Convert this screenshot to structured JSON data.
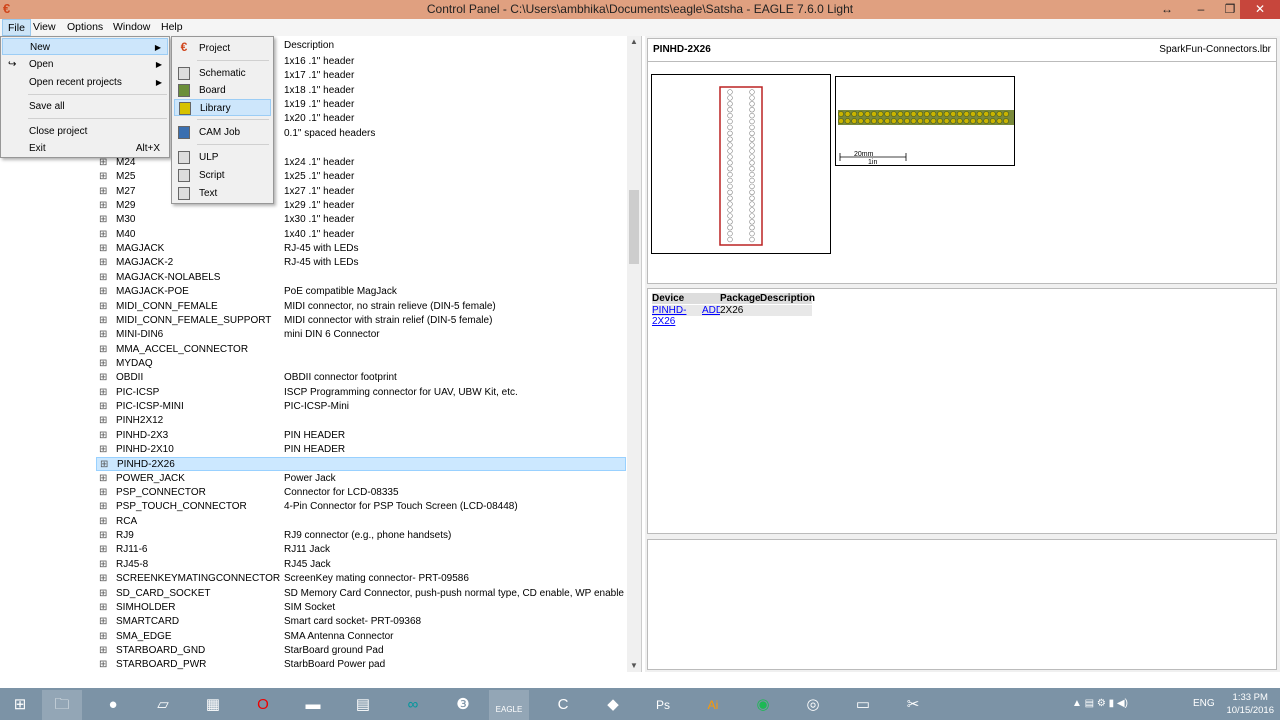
{
  "window": {
    "title": "Control Panel - C:\\Users\\ambhika\\Documents\\eagle\\Satsha - EAGLE 7.6.0 Light",
    "minimize": "–",
    "restore": "❐",
    "close": "✕",
    "extra": "↔"
  },
  "menubar": [
    "File",
    "View",
    "Options",
    "Window",
    "Help"
  ],
  "file_menu": {
    "new": "New",
    "open": "Open",
    "open_recent": "Open recent projects",
    "save_all": "Save all",
    "close_project": "Close project",
    "exit": "Exit",
    "exit_accel": "Alt+X"
  },
  "new_submenu": [
    "Project",
    "Schematic",
    "Board",
    "Library",
    "CAM Job",
    "ULP",
    "Script",
    "Text"
  ],
  "list": {
    "description_header": "Description",
    "top_descriptions": [
      "1x16 .1\" header",
      "1x17 .1\" header",
      "1x18 .1\" header",
      "1x19 .1\" header",
      "1x20 .1\" header",
      "0.1\" spaced headers"
    ],
    "rows": [
      {
        "name": "M24",
        "desc": "1x24 .1\" header"
      },
      {
        "name": "M25",
        "desc": "1x25 .1\" header"
      },
      {
        "name": "M27",
        "desc": "1x27 .1\" header"
      },
      {
        "name": "M29",
        "desc": "1x29 .1\" header"
      },
      {
        "name": "M30",
        "desc": "1x30 .1\" header"
      },
      {
        "name": "M40",
        "desc": "1x40 .1\" header"
      },
      {
        "name": "MAGJACK",
        "desc": "RJ-45 with LEDs"
      },
      {
        "name": "MAGJACK-2",
        "desc": "RJ-45 with LEDs"
      },
      {
        "name": "MAGJACK-NOLABELS",
        "desc": ""
      },
      {
        "name": "MAGJACK-POE",
        "desc": "PoE compatible MagJack"
      },
      {
        "name": "MIDI_CONN_FEMALE",
        "desc": "MIDI connector, no strain relieve (DIN-5 female)"
      },
      {
        "name": "MIDI_CONN_FEMALE_SUPPORT",
        "desc": "MIDI connector with strain relief (DIN-5 female)"
      },
      {
        "name": "MINI-DIN6",
        "desc": "mini DIN 6 Connector"
      },
      {
        "name": "MMA_ACCEL_CONNECTOR",
        "desc": ""
      },
      {
        "name": "MYDAQ",
        "desc": ""
      },
      {
        "name": "OBDII",
        "desc": "OBDII connector footprint"
      },
      {
        "name": "PIC-ICSP",
        "desc": "ISCP Programming connector for UAV, UBW Kit, etc."
      },
      {
        "name": "PIC-ICSP-MINI",
        "desc": "PIC-ICSP-Mini"
      },
      {
        "name": "PINH2X12",
        "desc": ""
      },
      {
        "name": "PINHD-2X3",
        "desc": "PIN HEADER"
      },
      {
        "name": "PINHD-2X10",
        "desc": "PIN HEADER"
      },
      {
        "name": "PINHD-2X26",
        "desc": ""
      },
      {
        "name": "POWER_JACK",
        "desc": "Power Jack"
      },
      {
        "name": "PSP_CONNECTOR",
        "desc": "Connector for LCD-08335"
      },
      {
        "name": "PSP_TOUCH_CONNECTOR",
        "desc": "4-Pin Connector for PSP Touch Screen (LCD-08448)"
      },
      {
        "name": "RCA",
        "desc": ""
      },
      {
        "name": "RJ9",
        "desc": "RJ9 connector (e.g., phone handsets)"
      },
      {
        "name": "RJ11-6",
        "desc": "RJ11 Jack"
      },
      {
        "name": "RJ45-8",
        "desc": "RJ45 Jack"
      },
      {
        "name": "SCREENKEYMATINGCONNECTOR",
        "desc": "ScreenKey mating connector- PRT-09586"
      },
      {
        "name": "SD_CARD_SOCKET",
        "desc": "SD Memory Card Connector, push-push normal type, CD enable, WP enable"
      },
      {
        "name": "SIMHOLDER",
        "desc": "SIM Socket"
      },
      {
        "name": "SMARTCARD",
        "desc": "Smart card socket- PRT-09368"
      },
      {
        "name": "SMA_EDGE",
        "desc": "SMA Antenna Connector"
      },
      {
        "name": "STARBOARD_GND",
        "desc": "StarBoard ground Pad"
      },
      {
        "name": "STARBOARD_PWR",
        "desc": "StarbBoard Power pad"
      }
    ]
  },
  "preview": {
    "name": "PINHD-2X26",
    "library": "SparkFun-Connectors.lbr",
    "scale_mm": "20mm",
    "scale_in": "1in"
  },
  "device_table": {
    "headers": [
      "Device",
      "Package",
      "Description"
    ],
    "device": "PINHD-2X26",
    "add": "ADD",
    "package": "2X26"
  },
  "taskbar": {
    "lang": "ENG",
    "time": "1:33 PM",
    "date": "10/15/2016",
    "eagle_label": "EAGLE"
  },
  "colors": {
    "titlebar": "#e0a080",
    "selection": "#cce8ff",
    "taskbar": "#7c93a6"
  }
}
